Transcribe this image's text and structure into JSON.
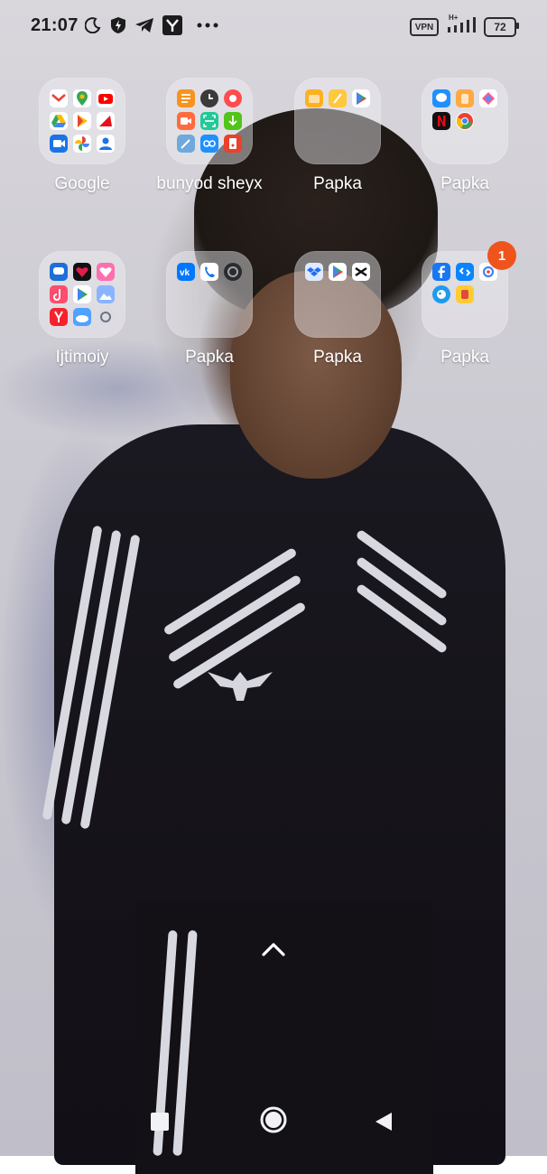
{
  "status_bar": {
    "time": "21:07",
    "left_icons": [
      "moon-icon",
      "shield-bolt-icon",
      "telegram-icon",
      "y-app-icon",
      "more-dots-icon"
    ],
    "vpn_label": "VPN",
    "network_label": "H+",
    "battery_level": "72"
  },
  "folders": [
    {
      "label": "Google",
      "apps": [
        "gmail",
        "maps",
        "youtube",
        "drive",
        "play-movies",
        "youtube-music",
        "meet",
        "photos",
        "contacts"
      ]
    },
    {
      "label": "bunyod sheyx",
      "apps": [
        "notes",
        "clock",
        "recorder",
        "video",
        "scanner",
        "downloads",
        "pen",
        "link",
        "gallery"
      ]
    },
    {
      "label": "Papka",
      "apps": [
        "files",
        "notepad",
        "play-store"
      ]
    },
    {
      "label": "Papka",
      "apps": [
        "messages",
        "jars",
        "shortcut",
        "netflix",
        "chrome"
      ]
    },
    {
      "label": "Ijtimoiy",
      "apps": [
        "chat",
        "heart-app",
        "like-app",
        "tiktok",
        "play-games",
        "wallpaper",
        "yandex",
        "weather",
        "settings-wheel"
      ]
    },
    {
      "label": "Papka",
      "apps": [
        "vk",
        "phone",
        "camera-round"
      ]
    },
    {
      "label": "Papka",
      "apps": [
        "dropbox",
        "play-store",
        "capcut"
      ]
    },
    {
      "label": "Papka",
      "apps": [
        "facebook",
        "shazam",
        "lens",
        "theme",
        "security"
      ],
      "badge": "1"
    }
  ],
  "navigation": {
    "items": [
      "recent-apps",
      "home",
      "back"
    ]
  },
  "colors": {
    "badge": "#f0541d",
    "label": "#ffffff"
  }
}
